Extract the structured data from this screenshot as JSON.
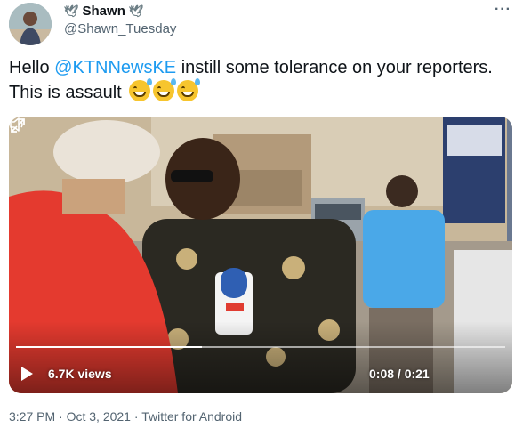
{
  "user": {
    "name": "Shawn",
    "handle": "@Shawn_Tuesday",
    "name_icon": "dove-icon"
  },
  "more_label": "···",
  "tweet": {
    "text_before": "Hello ",
    "mention": "@KTNNewsKE",
    "text_after": " instill some tolerance on your reporters. This is assault",
    "emoji_count": 3,
    "emoji_name": "grinning-sweat-emoji"
  },
  "video": {
    "views": "6.7K views",
    "time": "0:08 / 0:21",
    "progress": 0.38,
    "play_icon": "play-icon",
    "volume_icon": "volume-icon",
    "fullscreen_icon": "fullscreen-icon"
  },
  "meta": {
    "time": "3:27 PM",
    "date": "Oct 3, 2021",
    "source": "Twitter for Android",
    "sep": " · "
  },
  "colors": {
    "accent": "#1d9bf0",
    "secondary_text": "#536471"
  }
}
